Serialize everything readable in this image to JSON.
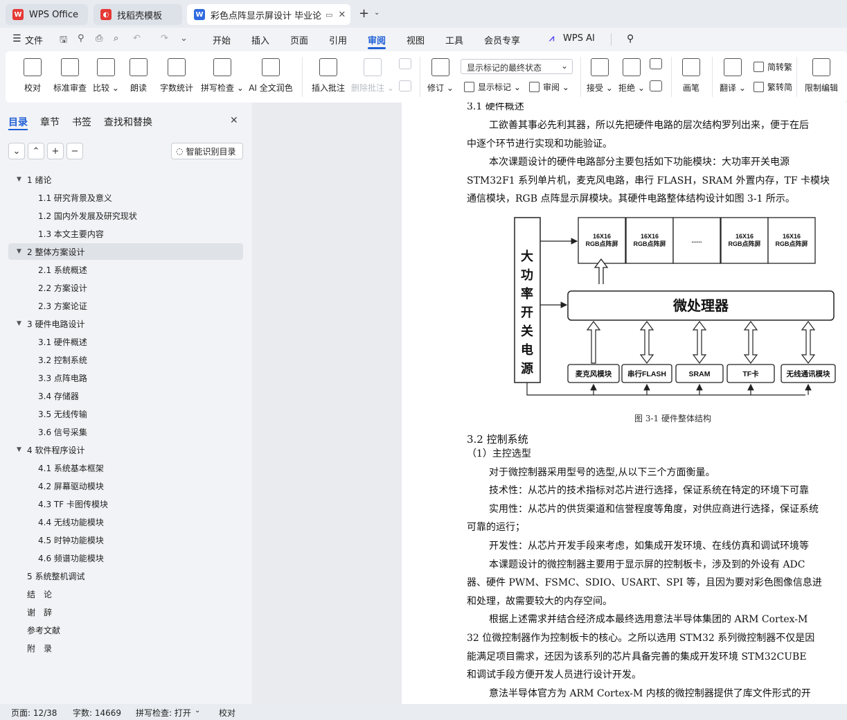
{
  "tabs": [
    {
      "label": "WPS Office"
    },
    {
      "label": "找稻壳模板"
    },
    {
      "label": "彩色点阵显示屏设计 毕业论文"
    }
  ],
  "menu": {
    "file": "文件",
    "items": [
      "开始",
      "插入",
      "页面",
      "引用",
      "审阅",
      "视图",
      "工具",
      "会员专享"
    ],
    "ai": "WPS AI",
    "active": "审阅"
  },
  "ribbon": {
    "proof": "校对",
    "std_review": "标准审查",
    "compare": "比较",
    "read_aloud": "朗读",
    "word_count": "字数统计",
    "spell_check": "拼写检查",
    "ai_polish": "AI 全文润色",
    "insert_comment": "插入批注",
    "delete_comment": "删除批注",
    "track_changes": "修订",
    "markup_mode": "显示标记的最终状态",
    "show_markup": "显示标记",
    "review_pane": "审阅",
    "accept": "接受",
    "reject": "拒绝",
    "pen": "画笔",
    "translate": "翻译",
    "to_trad": "简转繁",
    "to_simp": "繁转简",
    "restrict": "限制编辑"
  },
  "nav": {
    "tabs": [
      "目录",
      "章节",
      "书签",
      "查找和替换"
    ],
    "active": "目录",
    "smart_btn": "智能识别目录"
  },
  "toc": [
    {
      "num": "1",
      "title": "绪论",
      "level": 1
    },
    {
      "num": "1.1",
      "title": "研究背景及意义",
      "level": 2
    },
    {
      "num": "1.2",
      "title": "国内外发展及研究现状",
      "level": 2
    },
    {
      "num": "1.3",
      "title": "本文主要内容",
      "level": 2
    },
    {
      "num": "2",
      "title": "整体方案设计",
      "level": 1
    },
    {
      "num": "2.1",
      "title": "系统概述",
      "level": 2
    },
    {
      "num": "2.2",
      "title": "方案设计",
      "level": 2
    },
    {
      "num": "2.3",
      "title": "方案论证",
      "level": 2
    },
    {
      "num": "3",
      "title": "硬件电路设计",
      "level": 1
    },
    {
      "num": "3.1",
      "title": "硬件概述",
      "level": 2
    },
    {
      "num": "3.2",
      "title": "控制系统",
      "level": 2
    },
    {
      "num": "3.3",
      "title": "点阵电路",
      "level": 2
    },
    {
      "num": "3.4",
      "title": "存储器",
      "level": 2
    },
    {
      "num": "3.5",
      "title": "无线传输",
      "level": 2
    },
    {
      "num": "3.6",
      "title": "信号采集",
      "level": 2
    },
    {
      "num": "4",
      "title": "软件程序设计",
      "level": 1
    },
    {
      "num": "4.1",
      "title": "系统基本框架",
      "level": 2
    },
    {
      "num": "4.2",
      "title": "屏幕驱动模块",
      "level": 2
    },
    {
      "num": "4.3",
      "title": "TF 卡图传模块",
      "level": 2
    },
    {
      "num": "4.4",
      "title": "无线功能模块",
      "level": 2
    },
    {
      "num": "4.5",
      "title": "时钟功能模块",
      "level": 2
    },
    {
      "num": "4.6",
      "title": "频谱功能模块",
      "level": 2
    },
    {
      "num": "5",
      "title": "系统整机调试",
      "level": 1
    },
    {
      "num": "",
      "title": "结　论",
      "level": 0
    },
    {
      "num": "",
      "title": "谢　辞",
      "level": 0
    },
    {
      "num": "",
      "title": "参考文献",
      "level": 0
    },
    {
      "num": "",
      "title": "附　录",
      "level": 0
    }
  ],
  "doc": {
    "lines": [
      "3.1  硬件概述",
      "工欲善其事必先利其器，所以先把硬件电路的层次结构罗列出来，便于在后",
      "中逐个环节进行实现和功能验证。",
      "本次课题设计的硬件电路部分主要包括如下功能模块：大功率开关电源",
      "STM32F1 系列单片机，麦克风电路，串行 FLASH，SRAM 外置内存，TF 卡模块",
      "通信模块，RGB 点阵显示屏模块。其硬件电路整体结构设计如图 3-1 所示。",
      "图 3-1 硬件整体结构",
      "3.2  控制系统",
      "（1）主控选型",
      "对于微控制器采用型号的选型,从以下三个方面衡量。",
      "技术性：从芯片的技术指标对芯片进行选择，保证系统在特定的环境下可靠",
      "实用性：从芯片的供货渠道和信誉程度等角度，对供应商进行选择，保证系统",
      "可靠的运行；",
      "开发性：从芯片开发手段来考虑，如集成开发环境、在线仿真和调试环境等",
      "本课题设计的微控制器主要用于显示屏的控制板卡，涉及到的外设有 ADC",
      "器、硬件 PWM、FSMC、SDIO、USART、SPI 等，且因为要对彩色图像信息进",
      "和处理，故需要较大的内存空间。",
      "根据上述需求并结合经济成本最终选用意法半导体集团的 ARM Cortex-M",
      "32 位微控制器作为控制板卡的核心。之所以选用 STM32 系列微控制器不仅是因",
      "能满足项目需求，还因为该系列的芯片具备完善的集成开发环境 STM32CUBE",
      "和调试手段方便开发人员进行设计开发。",
      "意法半导体官方为 ARM Cortex-M 内核的微控制器提供了库文件形式的开"
    ],
    "diagram": {
      "power": "大功率开关电源",
      "screens": [
        [
          "16X16",
          "RGB点阵屏"
        ],
        [
          "16X16",
          "RGB点阵屏"
        ],
        [
          "......",
          ""
        ],
        [
          "16X16",
          "RGB点阵屏"
        ],
        [
          "16X16",
          "RGB点阵屏"
        ]
      ],
      "mcu": "微处理器",
      "modules": [
        "麦克风模块",
        "串行FLASH",
        "SRAM",
        "TF卡",
        "无线通讯模块"
      ]
    }
  },
  "status": {
    "page": "页面: 12/38",
    "words": "字数: 14669",
    "spell": "拼写检查: 打开",
    "proof": "校对"
  }
}
